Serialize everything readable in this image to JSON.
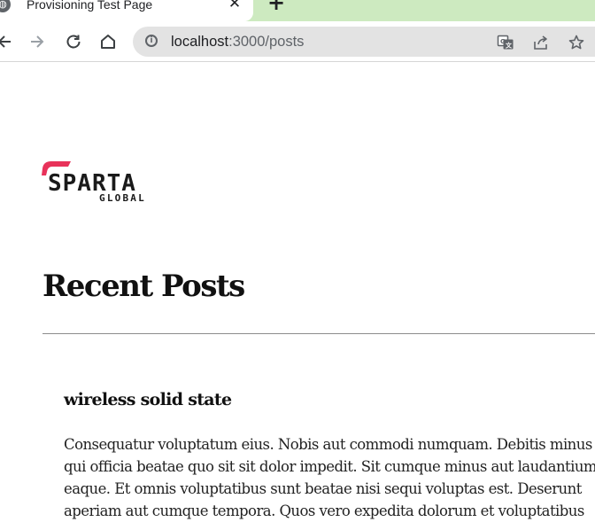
{
  "browser": {
    "tab": {
      "title": "Provisioning Test Page",
      "close_glyph": "✕",
      "favicon": "globe-icon"
    },
    "new_tab_glyph": "+",
    "toolbar": {
      "back": "back-arrow-icon",
      "forward": "forward-arrow-icon",
      "reload": "reload-icon",
      "home": "home-icon"
    },
    "omnibox": {
      "host": "localhost",
      "path": ":3000/posts",
      "icons": [
        "translate-icon",
        "share-icon",
        "bookmark-star-icon"
      ]
    },
    "colors": {
      "tab_strip": "#cdeac0",
      "omnibox_bg": "#e3e3e3"
    }
  },
  "page": {
    "logo": {
      "text": "SPARTA",
      "subtext": "GLOBAL",
      "accent_color": "#e8325a"
    },
    "heading": "Recent Posts",
    "posts": [
      {
        "title": "wireless solid state",
        "body_lines": [
          "Consequatur voluptatum eius. Nobis aut commodi numquam. Debitis minus",
          "qui officia beatae quo sit sit dolor impedit. Sit cumque minus aut laudantium",
          "eaque. Et omnis voluptatibus sunt beatae nisi sequi voluptas est. Deserunt",
          "aperiam aut cumque tempora. Quos vero expedita dolorum et voluptatibus"
        ]
      }
    ]
  }
}
